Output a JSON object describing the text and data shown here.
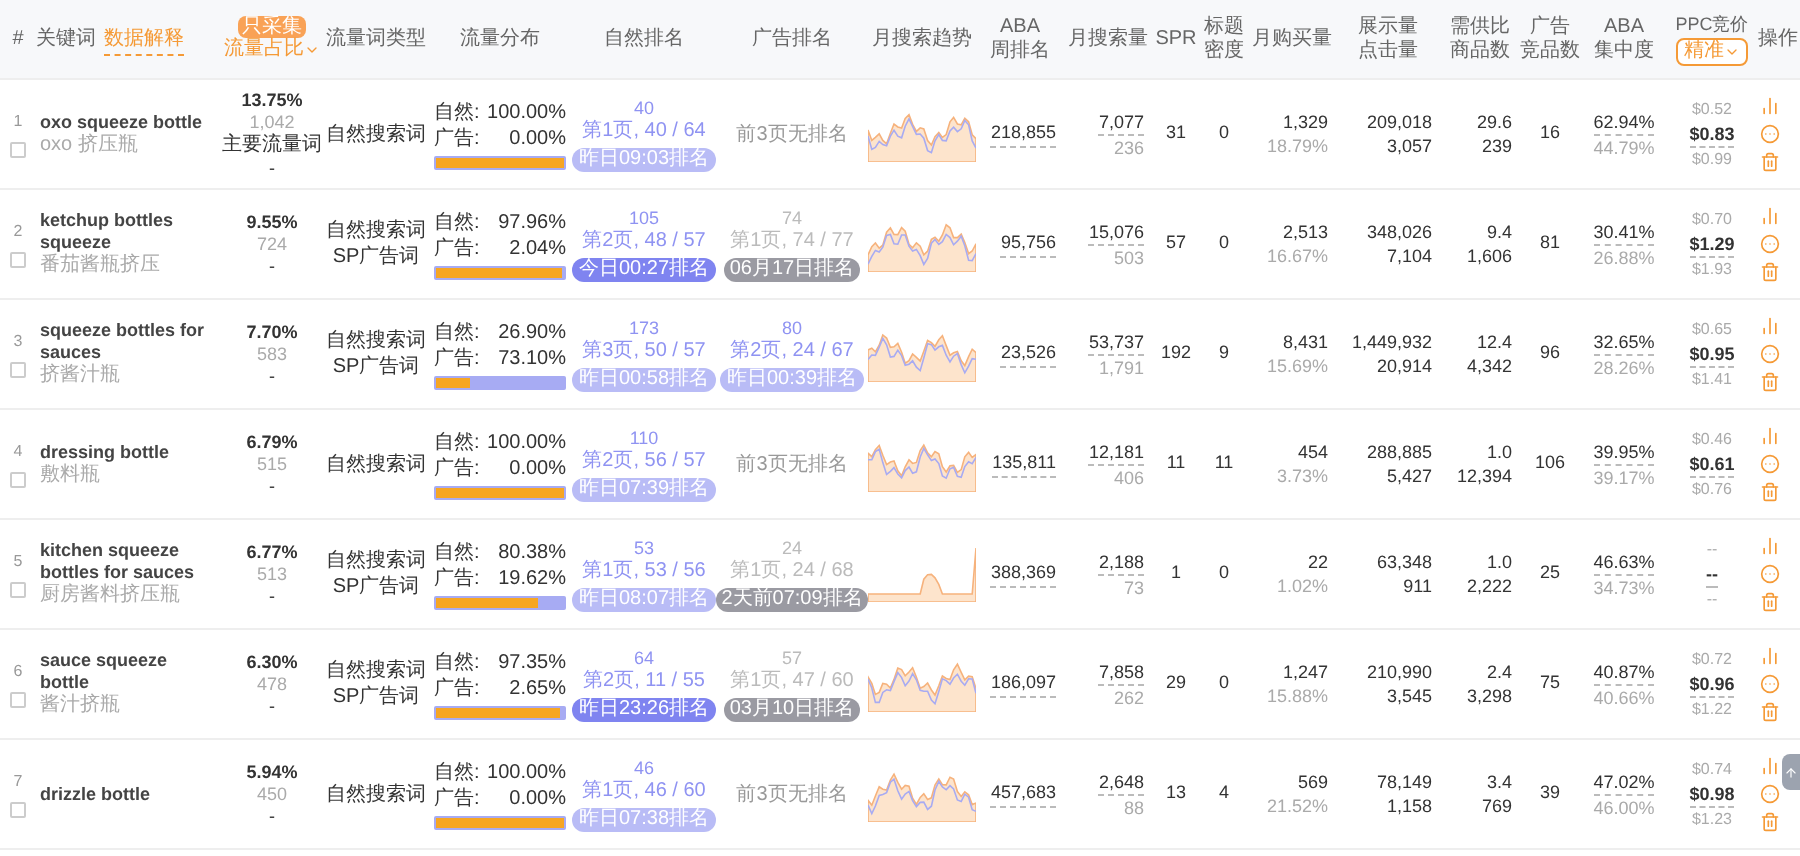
{
  "header": {
    "index": "#",
    "keyword": "关键词",
    "explain_link": "数据解释",
    "share_badge": "只采集",
    "share": "流量占比",
    "type": "流量词类型",
    "distribution": "流量分布",
    "natural_rank": "自然排名",
    "ad_rank": "广告排名",
    "trend": "月搜索趋势",
    "aba_rank": [
      "ABA",
      "周排名"
    ],
    "search_volume": "月搜索量",
    "spr": "SPR",
    "title_density": [
      "标题",
      "密度"
    ],
    "purchases": "月购买量",
    "impressions": [
      "展示量",
      "点击量"
    ],
    "supply_ratio": [
      "需供比",
      "商品数"
    ],
    "ad_products": [
      "广告",
      "竞品数"
    ],
    "aba_concentration": [
      "ABA",
      "集中度"
    ],
    "ppc": "PPC竞价",
    "ppc_filter": "精准",
    "actions": "操作"
  },
  "rows": [
    {
      "index": "1",
      "checked": false,
      "keyword": "oxo squeeze bottle",
      "keyword_cn": "oxo 挤压瓶",
      "share": "13.75%",
      "share_count": "1,042",
      "share_tag": "主要流量词",
      "share_dash": "-",
      "types": [
        "自然搜索词"
      ],
      "distribution": {
        "natural_label": "自然:",
        "natural_value": "100.00%",
        "ad_label": "广告:",
        "ad_value": "0.00%",
        "level": 1.0
      },
      "natural_rank": {
        "kind": "ranked",
        "rank": "40",
        "page": "第1页, 40 / 64",
        "badge": {
          "kind": "light",
          "text": "昨日09:03排名"
        }
      },
      "ad_rank": {
        "kind": "none",
        "text": "前3页无排名"
      },
      "aba_rank": "218,855",
      "search_volume": "7,077",
      "search_sub": "236",
      "spr": "31",
      "title_density": "0",
      "purchases": "1,329",
      "purchase_rate": "18.79%",
      "impressions": "209,018",
      "clicks": "3,057",
      "supply_ratio": "29.6",
      "products": "239",
      "ad_products": "16",
      "aba_concentration": "62.94%",
      "aba_concentration_sub": "44.79%",
      "ppc": {
        "low": "$0.52",
        "mid": "$0.83",
        "high": "$0.99"
      }
    },
    {
      "index": "2",
      "checked": false,
      "keyword": "ketchup bottles squeeze",
      "keyword_cn": "番茄酱瓶挤压",
      "share": "9.55%",
      "share_count": "724",
      "share_dash": "-",
      "types": [
        "自然搜索词",
        "SP广告词"
      ],
      "distribution": {
        "natural_label": "自然:",
        "natural_value": "97.96%",
        "ad_label": "广告:",
        "ad_value": "2.04%",
        "level": 0.98
      },
      "natural_rank": {
        "kind": "ranked",
        "rank": "105",
        "page": "第2页, 48 / 57",
        "badge": {
          "kind": "dark",
          "text": "今日00:27排名"
        }
      },
      "ad_rank": {
        "kind": "ranked",
        "rank": "74",
        "page": "第1页, 74 / 77",
        "badge": {
          "kind": "gray",
          "text": "06月17日排名"
        }
      },
      "aba_rank": "95,756",
      "search_volume": "15,076",
      "search_sub": "503",
      "spr": "57",
      "title_density": "0",
      "purchases": "2,513",
      "purchase_rate": "16.67%",
      "impressions": "348,026",
      "clicks": "7,104",
      "supply_ratio": "9.4",
      "products": "1,606",
      "ad_products": "81",
      "aba_concentration": "30.41%",
      "aba_concentration_sub": "26.88%",
      "ppc": {
        "low": "$0.70",
        "mid": "$1.29",
        "high": "$1.93"
      }
    },
    {
      "index": "3",
      "checked": false,
      "keyword": "squeeze bottles for sauces",
      "keyword_cn": "挤酱汁瓶",
      "share": "7.70%",
      "share_count": "583",
      "share_dash": "-",
      "types": [
        "自然搜索词",
        "SP广告词"
      ],
      "distribution": {
        "natural_label": "自然:",
        "natural_value": "26.90%",
        "ad_label": "广告:",
        "ad_value": "73.10%",
        "level": 0.27
      },
      "natural_rank": {
        "kind": "ranked",
        "rank": "173",
        "page": "第3页, 50 / 57",
        "badge": {
          "kind": "light",
          "text": "昨日00:58排名"
        }
      },
      "ad_rank": {
        "kind": "ranked",
        "rank": "80",
        "page": "第2页, 24 / 67",
        "badge": {
          "kind": "light",
          "text": "昨日00:39排名"
        }
      },
      "aba_rank": "23,526",
      "search_volume": "53,737",
      "search_sub": "1,791",
      "spr": "192",
      "title_density": "9",
      "purchases": "8,431",
      "purchase_rate": "15.69%",
      "impressions": "1,449,932",
      "clicks": "20,914",
      "supply_ratio": "12.4",
      "products": "4,342",
      "ad_products": "96",
      "aba_concentration": "32.65%",
      "aba_concentration_sub": "28.26%",
      "ppc": {
        "low": "$0.65",
        "mid": "$0.95",
        "high": "$1.41"
      }
    },
    {
      "index": "4",
      "checked": false,
      "keyword": "dressing bottle",
      "keyword_cn": "敷料瓶",
      "share": "6.79%",
      "share_count": "515",
      "share_dash": "-",
      "types": [
        "自然搜索词"
      ],
      "distribution": {
        "natural_label": "自然:",
        "natural_value": "100.00%",
        "ad_label": "广告:",
        "ad_value": "0.00%",
        "level": 1.0
      },
      "natural_rank": {
        "kind": "ranked",
        "rank": "110",
        "page": "第2页, 56 / 57",
        "badge": {
          "kind": "light",
          "text": "昨日07:39排名"
        }
      },
      "ad_rank": {
        "kind": "none",
        "text": "前3页无排名"
      },
      "aba_rank": "135,811",
      "search_volume": "12,181",
      "search_sub": "406",
      "spr": "11",
      "title_density": "11",
      "purchases": "454",
      "purchase_rate": "3.73%",
      "impressions": "288,885",
      "clicks": "5,427",
      "supply_ratio": "1.0",
      "products": "12,394",
      "ad_products": "106",
      "aba_concentration": "39.95%",
      "aba_concentration_sub": "39.17%",
      "ppc": {
        "low": "$0.46",
        "mid": "$0.61",
        "high": "$0.76"
      }
    },
    {
      "index": "5",
      "checked": false,
      "keyword": "kitchen squeeze bottles for sauces",
      "keyword_cn": "厨房酱料挤压瓶",
      "share": "6.77%",
      "share_count": "513",
      "share_dash": "-",
      "types": [
        "自然搜索词",
        "SP广告词"
      ],
      "distribution": {
        "natural_label": "自然:",
        "natural_value": "80.38%",
        "ad_label": "广告:",
        "ad_value": "19.62%",
        "level": 0.8
      },
      "natural_rank": {
        "kind": "ranked",
        "rank": "53",
        "page": "第1页, 53 / 56",
        "badge": {
          "kind": "light",
          "text": "昨日08:07排名"
        }
      },
      "ad_rank": {
        "kind": "ranked",
        "rank": "24",
        "page": "第1页, 24 / 68",
        "badge": {
          "kind": "gray",
          "text": "2天前07:09排名"
        }
      },
      "aba_rank": "388,369",
      "search_volume": "2,188",
      "search_sub": "73",
      "spr": "1",
      "title_density": "0",
      "purchases": "22",
      "purchase_rate": "1.02%",
      "impressions": "63,348",
      "clicks": "911",
      "supply_ratio": "1.0",
      "products": "2,222",
      "ad_products": "25",
      "aba_concentration": "46.63%",
      "aba_concentration_sub": "34.73%",
      "ppc": {
        "low": "--",
        "mid": "--",
        "high": "--"
      }
    },
    {
      "index": "6",
      "checked": false,
      "keyword": "sauce squeeze bottle",
      "keyword_cn": "酱汁挤瓶",
      "share": "6.30%",
      "share_count": "478",
      "share_dash": "-",
      "types": [
        "自然搜索词",
        "SP广告词"
      ],
      "distribution": {
        "natural_label": "自然:",
        "natural_value": "97.35%",
        "ad_label": "广告:",
        "ad_value": "2.65%",
        "level": 0.97
      },
      "natural_rank": {
        "kind": "ranked",
        "rank": "64",
        "page": "第2页, 11 / 55",
        "badge": {
          "kind": "dark",
          "text": "昨日23:26排名"
        }
      },
      "ad_rank": {
        "kind": "ranked",
        "rank": "57",
        "page": "第1页, 47 / 60",
        "badge": {
          "kind": "gray",
          "text": "03月10日排名"
        }
      },
      "aba_rank": "186,097",
      "search_volume": "7,858",
      "search_sub": "262",
      "spr": "29",
      "title_density": "0",
      "purchases": "1,247",
      "purchase_rate": "15.88%",
      "impressions": "210,990",
      "clicks": "3,545",
      "supply_ratio": "2.4",
      "products": "3,298",
      "ad_products": "75",
      "aba_concentration": "40.87%",
      "aba_concentration_sub": "40.66%",
      "ppc": {
        "low": "$0.72",
        "mid": "$0.96",
        "high": "$1.22"
      }
    },
    {
      "index": "7",
      "checked": false,
      "keyword": "drizzle bottle",
      "share": "5.94%",
      "share_count": "450",
      "share_dash": "-",
      "types": [
        "自然搜索词"
      ],
      "distribution": {
        "natural_label": "自然:",
        "natural_value": "100.00%",
        "ad_label": "广告:",
        "ad_value": "0.00%",
        "level": 1.0
      },
      "natural_rank": {
        "kind": "ranked",
        "rank": "46",
        "page": "第1页, 46 / 60",
        "badge": {
          "kind": "light",
          "text": "昨日07:38排名"
        }
      },
      "ad_rank": {
        "kind": "none",
        "text": "前3页无排名"
      },
      "aba_rank": "457,683",
      "search_volume": "2,648",
      "search_sub": "88",
      "spr": "13",
      "title_density": "4",
      "purchases": "569",
      "purchase_rate": "21.52%",
      "impressions": "78,149",
      "clicks": "1,158",
      "supply_ratio": "3.4",
      "products": "769",
      "ad_products": "39",
      "aba_concentration": "47.02%",
      "aba_concentration_sub": "46.00%",
      "ppc": {
        "low": "$0.74",
        "mid": "$0.98",
        "high": "$1.23"
      }
    }
  ]
}
